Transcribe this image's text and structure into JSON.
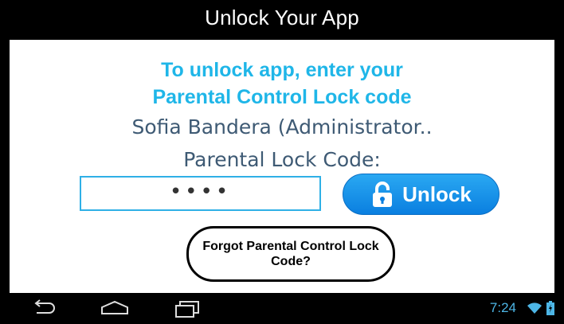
{
  "header": {
    "title": "Unlock Your App"
  },
  "main": {
    "heading_line1": "To unlock app, enter your",
    "heading_line2": "Parental Control Lock code",
    "user_name": "Sofia Bandera (Administrator..",
    "code_label": "Parental Lock Code:",
    "code_value": "••••",
    "unlock_label": "Unlock",
    "forgot_label": "Forgot Parental Control Lock Code?"
  },
  "navbar": {
    "icons": [
      "back-icon",
      "home-icon",
      "recent-apps-icon"
    ]
  },
  "status_bar": {
    "time": "7:24",
    "icons": [
      "wifi-icon",
      "battery-icon"
    ]
  },
  "colors": {
    "accent": "#1fb6e8",
    "button": "#0a7fe0",
    "text": "#3e5a74",
    "status": "#4db6e6"
  }
}
